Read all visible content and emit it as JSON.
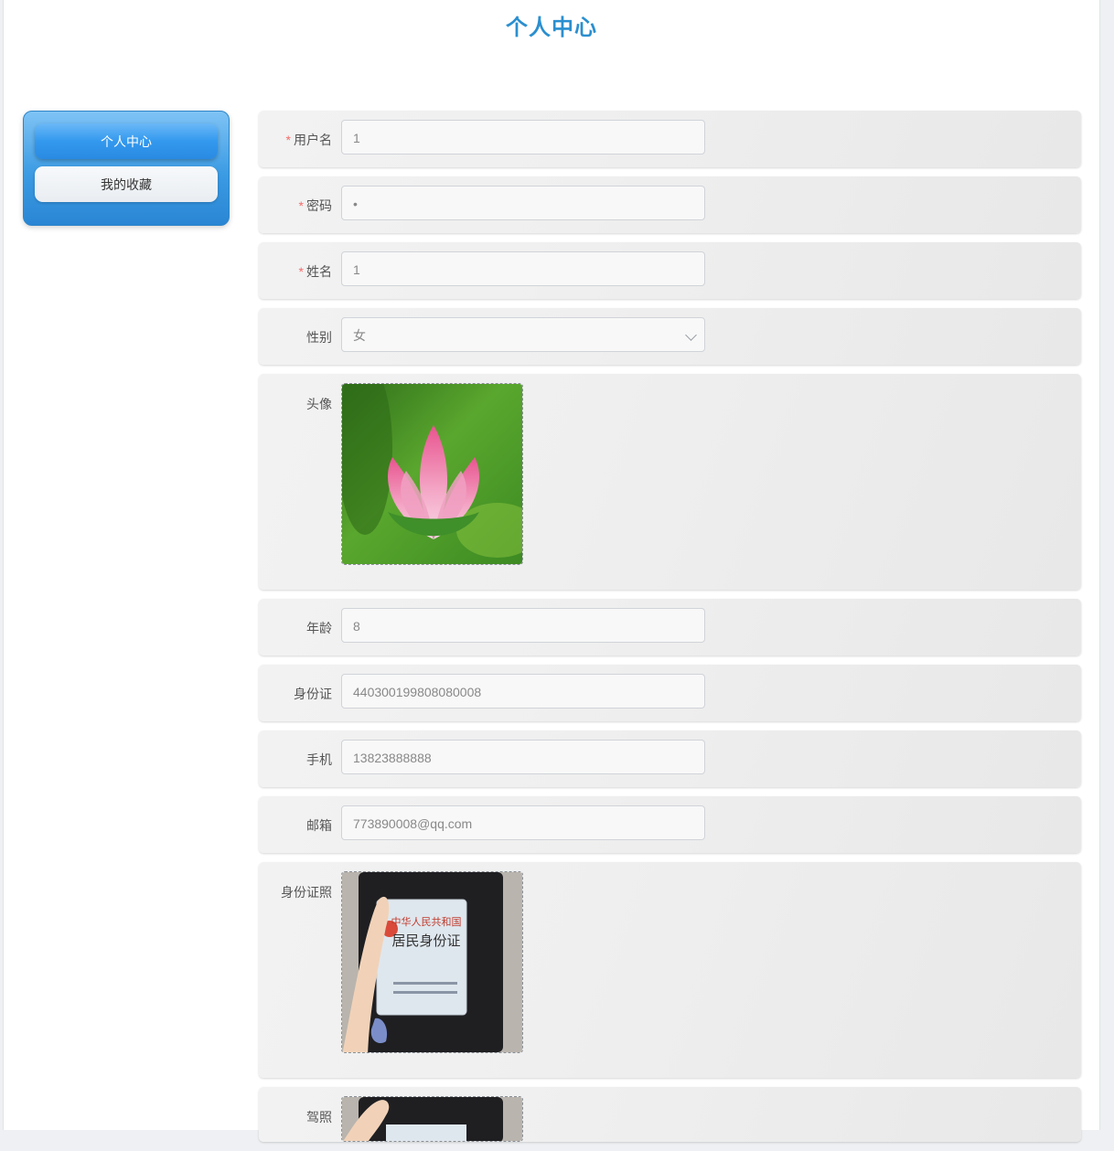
{
  "page": {
    "title": "个人中心"
  },
  "sidebar": {
    "items": [
      {
        "label": "个人中心",
        "active": true
      },
      {
        "label": "我的收藏",
        "active": false
      }
    ]
  },
  "form": {
    "username": {
      "label": "用户名",
      "required": true,
      "value": "1"
    },
    "password": {
      "label": "密码",
      "required": true,
      "value": "•"
    },
    "name": {
      "label": "姓名",
      "required": true,
      "value": "1"
    },
    "gender": {
      "label": "性别",
      "value": "女"
    },
    "avatar": {
      "label": "头像",
      "icon": "lotus-photo"
    },
    "age": {
      "label": "年龄",
      "value": "8"
    },
    "id_number": {
      "label": "身份证",
      "value": "440300199808080008"
    },
    "phone": {
      "label": "手机",
      "value": "13823888888"
    },
    "email": {
      "label": "邮箱",
      "value": "773890008@qq.com"
    },
    "id_photo": {
      "label": "身份证照",
      "icon": "id-card-photo"
    },
    "license": {
      "label": "驾照",
      "icon": "license-photo"
    }
  },
  "id_card": {
    "line1": "中华人民共和国",
    "line2": "居民身份证"
  },
  "colors": {
    "title": "#2b8fcf",
    "required": "#f56c6c",
    "menu_active": "#3399ee"
  }
}
